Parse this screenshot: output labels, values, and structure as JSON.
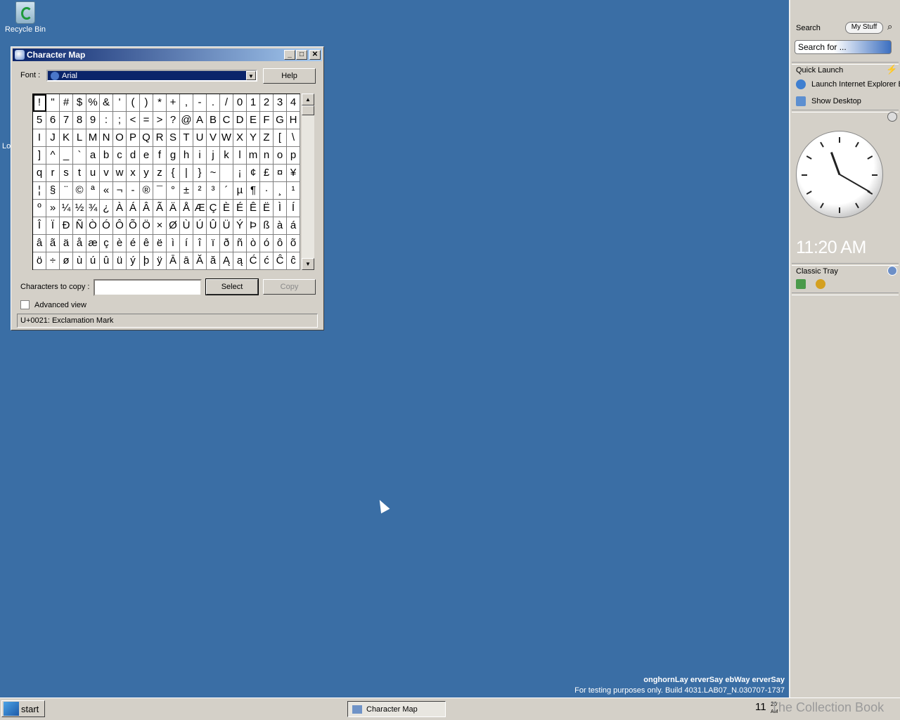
{
  "desktop": {
    "recycle_bin_label": "Recycle Bin",
    "partial_label": "Lo"
  },
  "window": {
    "title": "Character Map",
    "min_glyph": "_",
    "max_glyph": "□",
    "close_glyph": "✕",
    "font_label": "Font :",
    "font_value": "Arial",
    "help_label": "Help",
    "chars_to_copy_label": "Characters to copy :",
    "chars_to_copy_value": "",
    "select_label": "Select",
    "copy_label": "Copy",
    "advanced_view_label": "Advanced view",
    "advanced_view_checked": false,
    "status_text": "U+0021: Exclamation Mark",
    "grid": [
      [
        "!",
        "\"",
        "#",
        "$",
        "%",
        "&",
        "'",
        "(",
        ")",
        "*",
        "+",
        ",",
        "-",
        ".",
        "/",
        "0",
        "1",
        "2",
        "3",
        "4"
      ],
      [
        "5",
        "6",
        "7",
        "8",
        "9",
        ":",
        ";",
        "<",
        "=",
        ">",
        "?",
        "@",
        "A",
        "B",
        "C",
        "D",
        "E",
        "F",
        "G",
        "H"
      ],
      [
        "I",
        "J",
        "K",
        "L",
        "M",
        "N",
        "O",
        "P",
        "Q",
        "R",
        "S",
        "T",
        "U",
        "V",
        "W",
        "X",
        "Y",
        "Z",
        "[",
        "\\"
      ],
      [
        "]",
        "^",
        "_",
        "`",
        "a",
        "b",
        "c",
        "d",
        "e",
        "f",
        "g",
        "h",
        "i",
        "j",
        "k",
        "l",
        "m",
        "n",
        "o",
        "p"
      ],
      [
        "q",
        "r",
        "s",
        "t",
        "u",
        "v",
        "w",
        "x",
        "y",
        "z",
        "{",
        "|",
        "}",
        "~",
        " ",
        "¡",
        "¢",
        "£",
        "¤",
        "¥"
      ],
      [
        "¦",
        "§",
        "¨",
        "©",
        "ª",
        "«",
        "¬",
        "-",
        "®",
        "¯",
        "°",
        "±",
        "²",
        "³",
        "´",
        "µ",
        "¶",
        "·",
        "¸",
        "¹"
      ],
      [
        "º",
        "»",
        "¼",
        "½",
        "¾",
        "¿",
        "À",
        "Á",
        "Â",
        "Ã",
        "Ä",
        "Å",
        "Æ",
        "Ç",
        "È",
        "É",
        "Ê",
        "Ë",
        "Ì",
        "Í"
      ],
      [
        "Î",
        "Ï",
        "Ð",
        "Ñ",
        "Ò",
        "Ó",
        "Ô",
        "Õ",
        "Ö",
        "×",
        "Ø",
        "Ù",
        "Ú",
        "Û",
        "Ü",
        "Ý",
        "Þ",
        "ß",
        "à",
        "á"
      ],
      [
        "â",
        "ã",
        "ä",
        "å",
        "æ",
        "ç",
        "è",
        "é",
        "ê",
        "ë",
        "ì",
        "í",
        "î",
        "ï",
        "ð",
        "ñ",
        "ò",
        "ó",
        "ô",
        "õ"
      ],
      [
        "ö",
        "÷",
        "ø",
        "ù",
        "ú",
        "û",
        "ü",
        "ý",
        "þ",
        "ÿ",
        "Ā",
        "ā",
        "Ă",
        "ă",
        "Ą",
        "ą",
        "Ć",
        "ć",
        "Ĉ",
        "ĉ"
      ]
    ]
  },
  "sidebar": {
    "search_title": "Search",
    "my_stuff_label": "My Stuff",
    "search_placeholder": "Search for ...",
    "quick_launch_title": "Quick Launch",
    "quick_launch_items": [
      "Launch Internet Explorer Browser",
      "Show Desktop"
    ],
    "clock_time": "11:20 AM",
    "classic_tray_title": "Classic Tray"
  },
  "watermark": {
    "line1": "onghornLay erverSay ebWay erverSay",
    "line2": "For testing purposes only. Build 4031.LAB07_N.030707-1737"
  },
  "taskbar": {
    "start_label": "start",
    "task_label": "Character Map",
    "tray_time_main": "11",
    "tray_time_sup": "20",
    "tray_time_ampm": "AM"
  },
  "overlay_text": "The Collection Book"
}
